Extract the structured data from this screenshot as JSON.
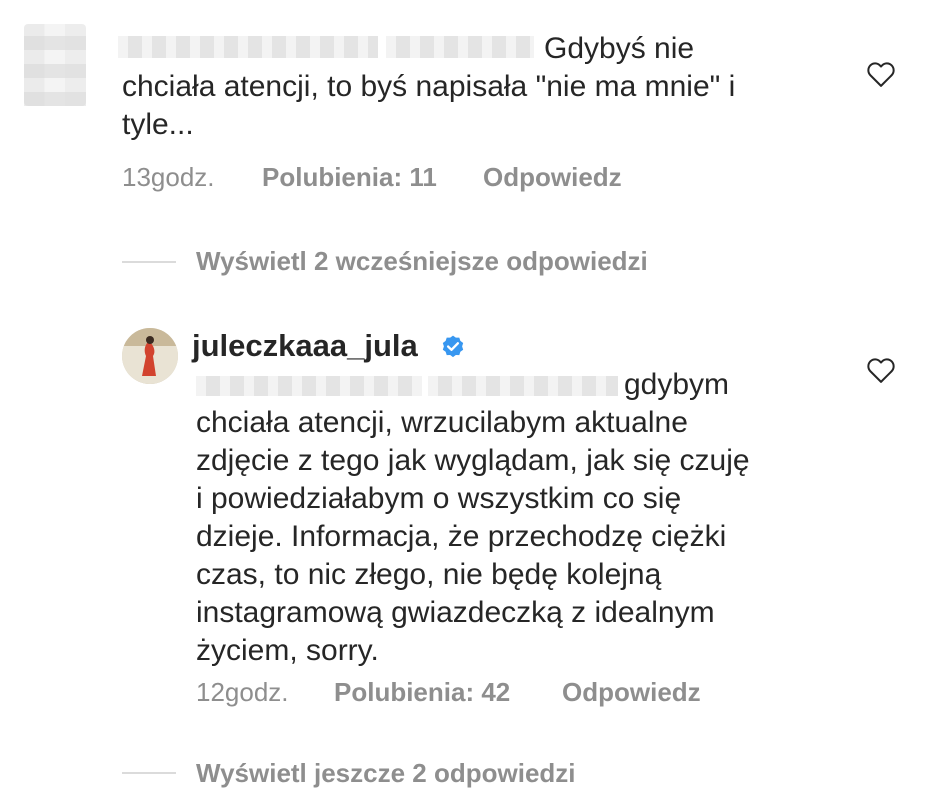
{
  "comment1": {
    "text_line1": "Gdybyś nie",
    "text_line2": "chciała atencji, to byś napisała \"nie ma mnie\" i",
    "text_line3": "tyle...",
    "time": "13godz.",
    "likes": "Polubienia: 11",
    "reply": "Odpowiedz"
  },
  "replies_toggle_1": "Wyświetl 2 wcześniejsze odpowiedzi",
  "comment2": {
    "username": "juleczkaaa_jula",
    "text_first": "gdybym",
    "text_lines": [
      "chciała atencji, wrzucilabym aktualne",
      "zdjęcie z tego jak wyglądam, jak się czuję",
      "i powiedziałabym o wszystkim co się",
      "dzieje. Informacja, że przechodzę ciężki",
      "czas, to nic złego, nie będę kolejną",
      "instagramową gwiazdeczką z idealnym",
      "życiem, sorry."
    ],
    "time": "12godz.",
    "likes": "Polubienia: 42",
    "reply": "Odpowiedz"
  },
  "replies_toggle_2": "Wyświetl jeszcze 2 odpowiedzi",
  "colors": {
    "text": "#262626",
    "secondary": "#8e8e8e",
    "verified": "#3897f0",
    "divider": "#dbdbdb"
  },
  "icons": {
    "like": "heart-outline-icon",
    "verified": "verified-badge-icon"
  }
}
